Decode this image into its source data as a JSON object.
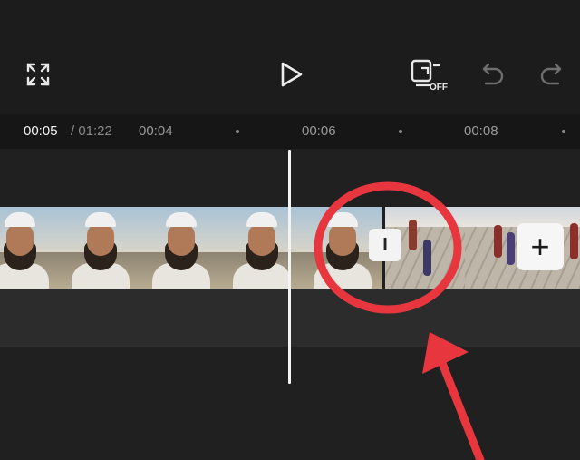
{
  "toolbar": {
    "fullscreen_icon": "fullscreen-icon",
    "play_icon": "play-icon",
    "keyframe_toggle_icon": "keyframe-off-icon",
    "keyframe_state": "OFF",
    "undo_icon": "undo-icon",
    "redo_icon": "redo-icon"
  },
  "timeline": {
    "current_time": "00:05",
    "total_time": "/ 01:22",
    "ticks": [
      "00:04",
      "00:06",
      "00:08"
    ]
  },
  "clips": {
    "transition_label": "I",
    "add_label": "+"
  },
  "annotation": {
    "color": "#e8363f"
  }
}
